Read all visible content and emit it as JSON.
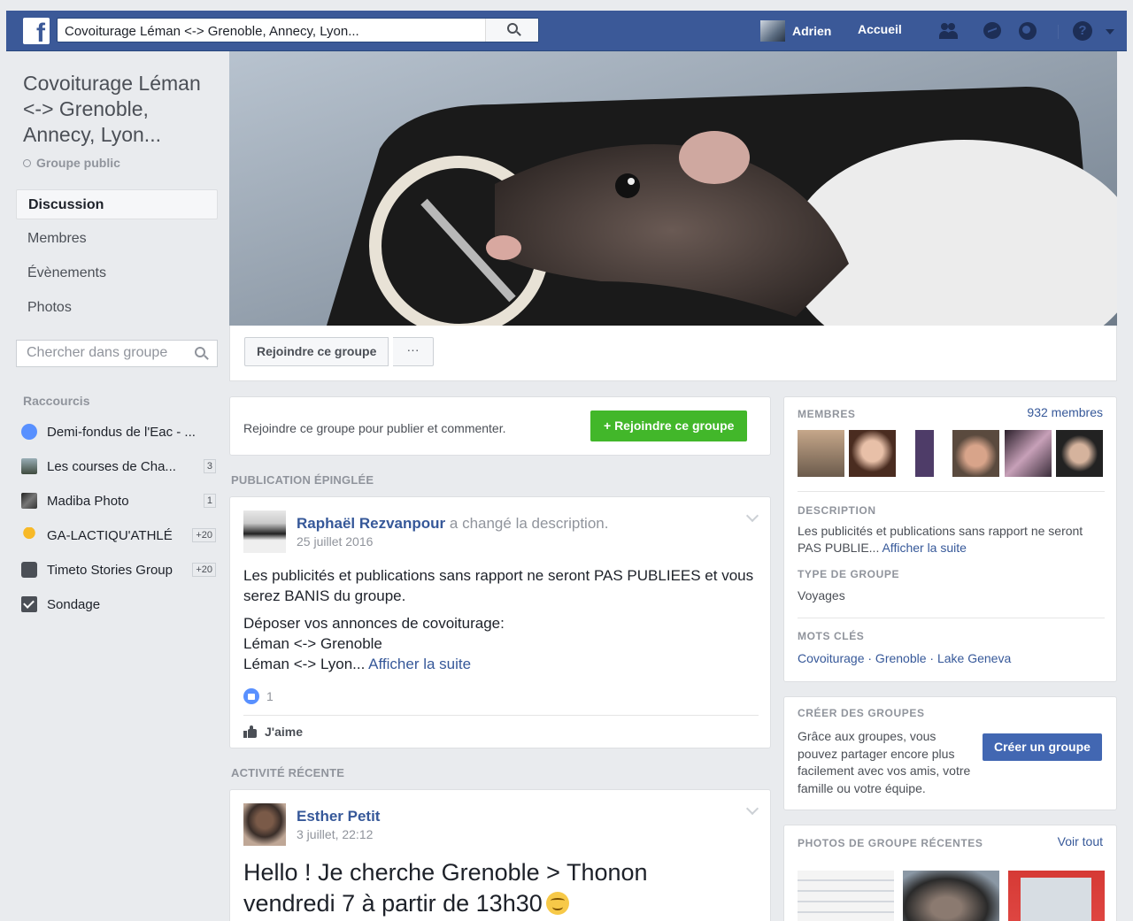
{
  "topbar": {
    "logo": "f",
    "search_value": "Covoiturage Léman <-> Grenoble, Annecy, Lyon...",
    "user_name": "Adrien",
    "home_label": "Accueil",
    "icons": [
      "friends-icon",
      "messages-icon",
      "globe-icon",
      "help-icon"
    ]
  },
  "group": {
    "title": "Covoiturage Léman <-> Grenoble, Annecy, Lyon...",
    "privacy": "Groupe public"
  },
  "sidebar": {
    "nav": [
      "Discussion",
      "Membres",
      "Évènements",
      "Photos"
    ],
    "search_placeholder": "Chercher dans groupe",
    "shortcuts_heading": "Raccourcis",
    "shortcuts": [
      {
        "label": "Demi-fondus de l'Eac - ...",
        "badge": ""
      },
      {
        "label": "Les courses de Cha...",
        "badge": "3"
      },
      {
        "label": "Madiba Photo",
        "badge": "1"
      },
      {
        "label": "GA-LACTIQU'ATHLÉ",
        "badge": "+20"
      },
      {
        "label": "Timeto Stories Group",
        "badge": "+20"
      },
      {
        "label": "Sondage",
        "badge": ""
      }
    ]
  },
  "cover": {
    "join_label": "Rejoindre ce groupe",
    "more_label": "···"
  },
  "join_card": {
    "text": "Rejoindre ce groupe pour publier et commenter.",
    "button": "+ Rejoindre ce groupe"
  },
  "pinned": {
    "heading": "PUBLICATION ÉPINGLÉE",
    "author": "Raphaël Rezvanpour",
    "action": "a changé la description.",
    "date": "25 juillet 2016",
    "body_1": "Les publicités et publications sans rapport ne seront PAS PUBLIEES et vous serez BANIS du groupe.",
    "body_2_line1": "Déposer vos annonces de covoiturage:",
    "body_2_line2": "Léman <-> Grenoble",
    "body_2_line3": "Léman <-> Lyon...",
    "see_more": "Afficher la suite",
    "likes": "1",
    "like_label": "J'aime"
  },
  "recent": {
    "heading": "ACTIVITÉ RÉCENTE",
    "author": "Esther Petit",
    "date": "3 juillet, 22:12",
    "line1": "Hello ! Je cherche Grenoble > Thonon",
    "line2": "vendredi 7 à partir de 13h30"
  },
  "about": {
    "members_heading": "MEMBRES",
    "members_count": "932 membres",
    "description_heading": "DESCRIPTION",
    "description_text": "Les publicités et publications sans rapport ne seront PAS PUBLIE...",
    "description_more": "Afficher la suite",
    "type_heading": "TYPE DE GROUPE",
    "type_value": "Voyages",
    "tags_heading": "MOTS CLÉS",
    "tags": "Covoiturage · Grenoble · Lake Geneva"
  },
  "create": {
    "heading": "CRÉER DES GROUPES",
    "text": "Grâce aux groupes, vous pouvez partager encore plus facilement avec vos amis, votre famille ou votre équipe.",
    "button": "Créer un groupe"
  },
  "photos": {
    "heading": "PHOTOS DE GROUPE RÉCENTES",
    "see_all": "Voir tout"
  },
  "colors": {
    "brand": "#3b5998",
    "join_green": "#42b72a",
    "link": "#365899",
    "create_blue": "#4267b2",
    "background": "#e9ebee"
  }
}
